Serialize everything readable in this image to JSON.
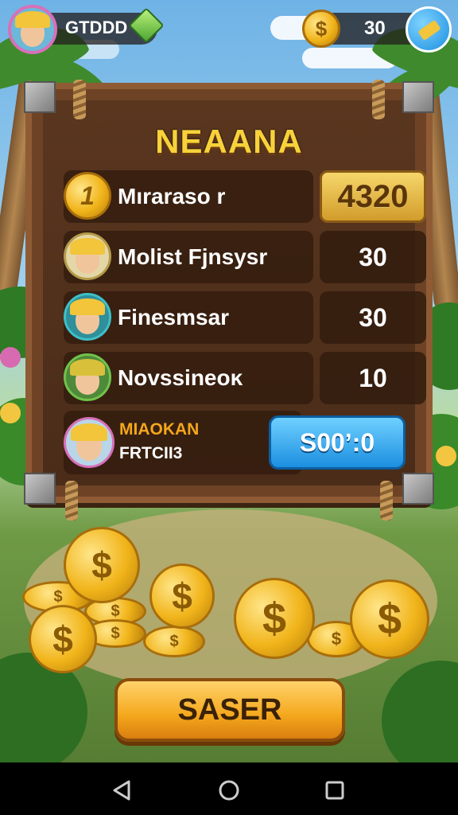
{
  "player": {
    "name": "GTDDD"
  },
  "currency": {
    "coins": "30"
  },
  "board": {
    "title": "NEAANA",
    "rows": [
      {
        "name": "Mıraraso r",
        "value": "4320",
        "icon": "coin-icon",
        "coin_glyph": "1"
      },
      {
        "name": "Molist Fjnsysr",
        "value": "30",
        "icon": "avatar-icon"
      },
      {
        "name": "Finesmsar",
        "value": "30",
        "icon": "avatar-icon"
      },
      {
        "name": "Novssineoĸ",
        "value": "10",
        "icon": "avatar-icon"
      }
    ],
    "player_row": {
      "line1": "MIAOKAN",
      "line2": "FRTCII3",
      "button_label": "S00ʼ:0"
    }
  },
  "coin_glyph": "$",
  "main_button": {
    "label": "SASER"
  },
  "colors": {
    "title": "#f7d23a",
    "board": "#6e4325",
    "accent_blue": "#1c8fe0",
    "accent_orange": "#f4a71c",
    "player_name": "#f4a71c"
  }
}
